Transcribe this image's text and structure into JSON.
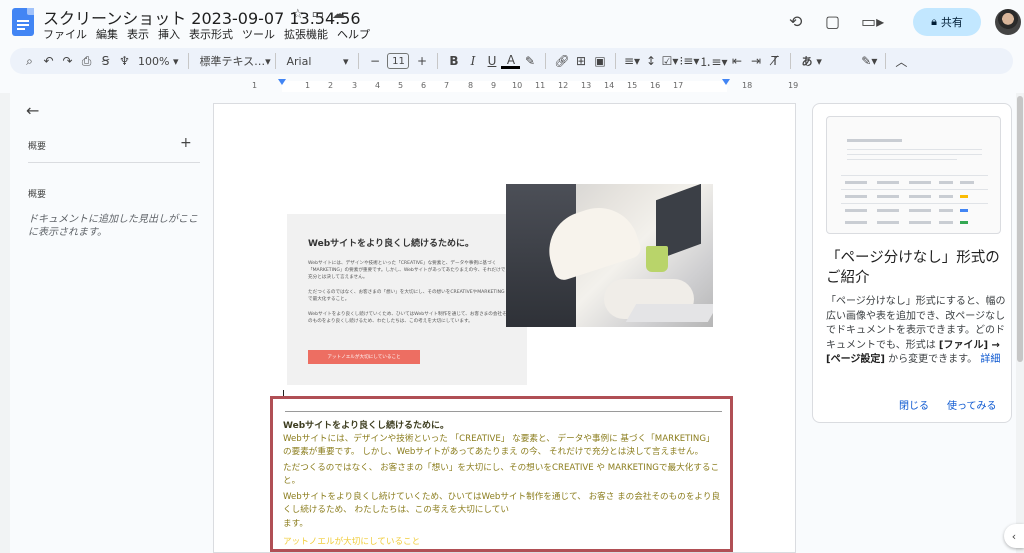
{
  "app": {
    "doc_title": "スクリーンショット 2023-09-07 13.54.56",
    "menu": [
      "ファイル",
      "編集",
      "表示",
      "挿入",
      "表示形式",
      "ツール",
      "拡張機能",
      "ヘルプ"
    ],
    "share_label": "共有"
  },
  "toolbar": {
    "zoom": "100%",
    "style": "標準テキス…",
    "font": "Arial",
    "font_size": "11",
    "bold": "B",
    "italic": "I",
    "underline": "U",
    "text_color": "A",
    "input_mode": "あ"
  },
  "ruler": {
    "ticks": [
      "1",
      "1",
      "2",
      "3",
      "4",
      "5",
      "6",
      "7",
      "8",
      "9",
      "10",
      "11",
      "12",
      "13",
      "14",
      "15",
      "16",
      "17",
      "18",
      "19"
    ]
  },
  "outline": {
    "summary_label": "概要",
    "outline_label": "概要",
    "empty_text": "ドキュメントに追加した見出しがここに表示されます。"
  },
  "hero": {
    "title": "Webサイトをより良くし続けるために。",
    "p1": "Webサイトには、デザインや技術といった「CREATIVE」な要素と、データや事例に基づく「MARKETING」の要素が重要です。しかし、Webサイトがあってあたりまえの今、それだけで充分とは決して言えません。",
    "p2": "ただつくるのではなく、お客さまの「想い」を大切にし、その想いをCREATIVEやMARKETINGで最大化すること。",
    "p3": "Webサイトをより良くし続けていくため、ひいてはWebサイト制作を通じて、お客さまの会社そのものをより良くし続けるため、わたしたちは、この考えを大切にしています。",
    "button": "アットノエルが大切にしていること"
  },
  "textbox": {
    "heading": "Webサイトをより良くし続けるために。",
    "p1": "Webサイトには、デザインや技術といった 「CREATIVE」 な要素と、 データや事例に 基づく「MARKETING」 の要素が重要です。 しかし、Webサイトがあってあたりまえ の今、 それだけで充分とは決して言えません。",
    "p2": "ただつくるのではなく、 お客さまの「想い」を大切にし、その想いをCREATIVE や MARKETINGで最大化すること。",
    "p3": "Webサイトをより良くし続けていくため、ひいてはWebサイト制作を通じて、 お客さ まの会社そのものをより良くし続けるため、 わたしたちは、この考えを大切にしてい",
    "p4": "ます。",
    "link": "アットノエルが大切にしていること"
  },
  "promo": {
    "title": "「ページ分けなし」形式のご紹介",
    "body_pre": "「ページ分けなし」形式にすると、幅の広い画像や表を追加でき、改ページなしでドキュメントを表示できます。どのドキュメントでも、形式は ",
    "body_bold": "[ファイル] → [ページ設定]",
    "body_post": " から変更できます。",
    "more_link": "詳細",
    "close_btn": "閉じる",
    "try_btn": "使ってみる"
  },
  "colors": {
    "accent": "#0b57d0",
    "share_bg": "#c2e7ff",
    "textbox_border": "#b04f55",
    "textbox_text": "#8b7d1d",
    "link_yellow": "#f0cc3a",
    "hero_button": "#ed6e62"
  }
}
